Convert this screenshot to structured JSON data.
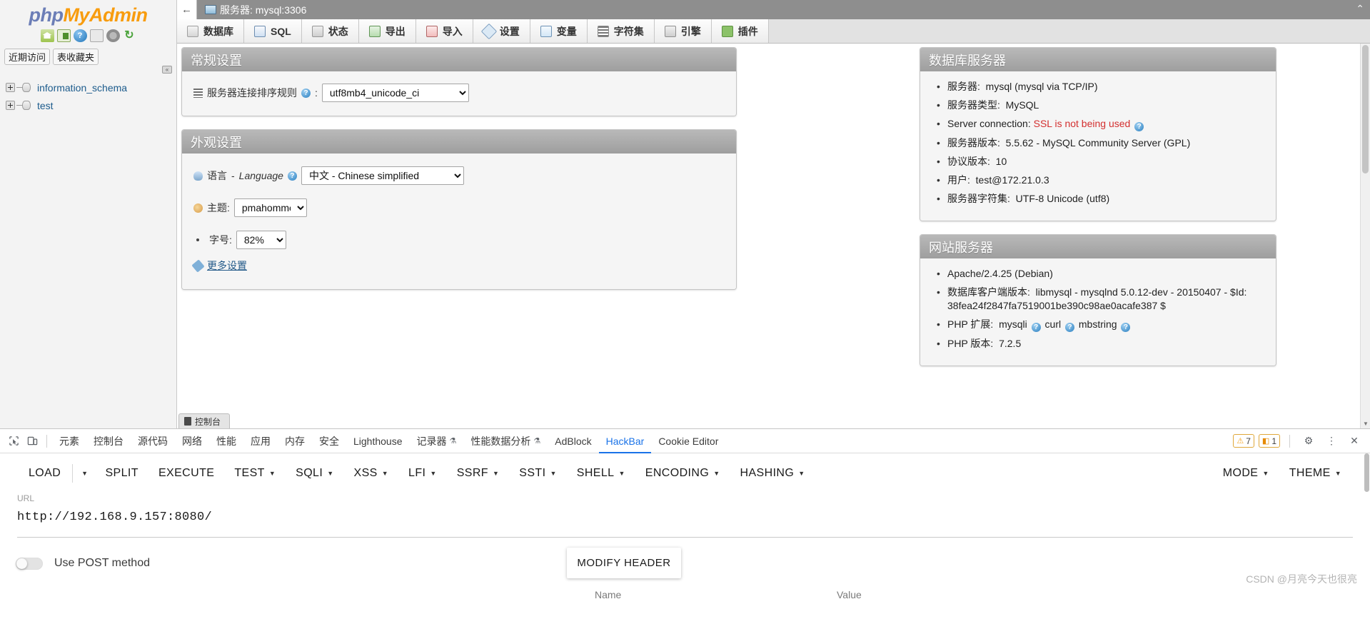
{
  "sidebar": {
    "logo": {
      "php": "php",
      "my": "My",
      "admin": "Admin"
    },
    "icons": [
      "home-icon",
      "exit-icon",
      "help-icon",
      "docs-icon",
      "settings-icon",
      "refresh-icon"
    ],
    "quick_buttons": [
      "近期访问",
      "表收藏夹"
    ],
    "collapse_label": "«",
    "databases": [
      "information_schema",
      "test"
    ]
  },
  "titlebar": {
    "back": "←",
    "title": "服务器: mysql:3306",
    "restore": "⌃"
  },
  "tabs": [
    {
      "label": "数据库",
      "icon": "database-icon"
    },
    {
      "label": "SQL",
      "icon": "sql-icon"
    },
    {
      "label": "状态",
      "icon": "status-icon"
    },
    {
      "label": "导出",
      "icon": "export-icon"
    },
    {
      "label": "导入",
      "icon": "import-icon"
    },
    {
      "label": "设置",
      "icon": "settings-wrench-icon"
    },
    {
      "label": "变量",
      "icon": "variables-icon"
    },
    {
      "label": "字符集",
      "icon": "charset-icon"
    },
    {
      "label": "引擎",
      "icon": "engines-icon"
    },
    {
      "label": "插件",
      "icon": "plugins-icon"
    }
  ],
  "general_settings": {
    "title": "常规设置",
    "collation_label": "服务器连接排序规则",
    "collation_help": "?",
    "collation_colon": ":",
    "collation_value": "utf8mb4_unicode_ci"
  },
  "appearance_settings": {
    "title": "外观设置",
    "language_label_cn": "语言",
    "language_dash": "-",
    "language_label_en": "Language",
    "language_help": "?",
    "language_value": "中文 - Chinese simplified",
    "theme_label": "主题:",
    "theme_value": "pmahomme",
    "fontsize_label": "字号:",
    "fontsize_value": "82%",
    "more_settings": "更多设置"
  },
  "database_server": {
    "title": "数据库服务器",
    "items": [
      {
        "label": "服务器:",
        "value": "mysql (mysql via TCP/IP)"
      },
      {
        "label": "服务器类型:",
        "value": "MySQL"
      },
      {
        "label": "Server connection:",
        "value": "SSL is not being used",
        "value_color": "#d32f2f",
        "help": "?"
      },
      {
        "label": "服务器版本:",
        "value": "5.5.62 - MySQL Community Server (GPL)"
      },
      {
        "label": "协议版本:",
        "value": "10"
      },
      {
        "label": "用户:",
        "value": "test@172.21.0.3"
      },
      {
        "label": "服务器字符集:",
        "value": "UTF-8 Unicode (utf8)"
      }
    ]
  },
  "web_server": {
    "title": "网站服务器",
    "items": [
      {
        "label": "",
        "value": "Apache/2.4.25 (Debian)"
      },
      {
        "label": "数据库客户端版本:",
        "value": "libmysql - mysqlnd 5.0.12-dev - 20150407 - $Id: 38fea24f2847fa7519001be390c98ae0acafe387 $"
      },
      {
        "label": "PHP 扩展:",
        "value": "mysqli   curl   mbstring",
        "exts": [
          "mysqli",
          "curl",
          "mbstring"
        ]
      },
      {
        "label": "PHP 版本:",
        "value": "7.2.5"
      }
    ]
  },
  "console_tab": {
    "label": "控制台"
  },
  "devtools": {
    "tabs": [
      {
        "label": "元素"
      },
      {
        "label": "控制台"
      },
      {
        "label": "源代码"
      },
      {
        "label": "网络"
      },
      {
        "label": "性能"
      },
      {
        "label": "应用"
      },
      {
        "label": "内存"
      },
      {
        "label": "安全"
      },
      {
        "label": "Lighthouse"
      },
      {
        "label": "记录器",
        "beaker": "⚗"
      },
      {
        "label": "性能数据分析",
        "beaker": "⚗"
      },
      {
        "label": "AdBlock"
      },
      {
        "label": "HackBar",
        "active": true
      },
      {
        "label": "Cookie Editor"
      }
    ],
    "warnings_count": "7",
    "issues_count": "1",
    "gear": "⚙",
    "kebab": "⋮",
    "close": "✕"
  },
  "hackbar": {
    "buttons": [
      {
        "label": "LOAD"
      },
      {
        "label": "",
        "caret": true,
        "caret_only": true
      },
      {
        "label": "SPLIT"
      },
      {
        "label": "EXECUTE"
      },
      {
        "label": "TEST",
        "caret": true
      },
      {
        "label": "SQLI",
        "caret": true
      },
      {
        "label": "XSS",
        "caret": true
      },
      {
        "label": "LFI",
        "caret": true
      },
      {
        "label": "SSRF",
        "caret": true
      },
      {
        "label": "SSTI",
        "caret": true
      },
      {
        "label": "SHELL",
        "caret": true
      },
      {
        "label": "ENCODING",
        "caret": true
      },
      {
        "label": "HASHING",
        "caret": true
      }
    ],
    "right_buttons": [
      {
        "label": "MODE",
        "caret": true
      },
      {
        "label": "THEME",
        "caret": true
      }
    ],
    "url_label": "URL",
    "url_value": "http://192.168.9.157:8080/",
    "post_toggle_label": "Use POST method",
    "modify_header_label": "MODIFY HEADER",
    "header_col_name": "Name",
    "header_col_value": "Value"
  },
  "watermark": "CSDN @月亮今天也很亮"
}
